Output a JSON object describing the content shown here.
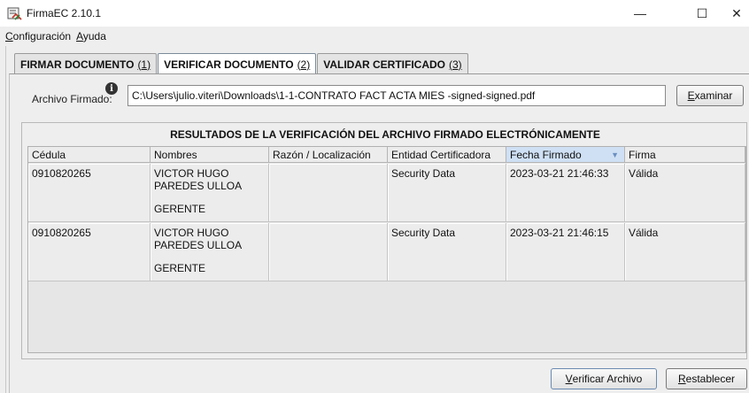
{
  "window": {
    "title": "FirmaEC 2.10.1",
    "minimize_glyph": "—",
    "maximize_glyph": "☐",
    "close_glyph": "✕"
  },
  "menu": {
    "items": [
      {
        "underlined": "C",
        "rest": "onfiguración"
      },
      {
        "underlined": "A",
        "rest": "yuda"
      }
    ]
  },
  "tabs": [
    {
      "label": "FIRMAR DOCUMENTO",
      "shortcut": "(1)",
      "active": false
    },
    {
      "label": "VERIFICAR DOCUMENTO",
      "shortcut": "(2)",
      "active": true
    },
    {
      "label": "VALIDAR CERTIFICADO",
      "shortcut": "(3)",
      "active": false
    }
  ],
  "file": {
    "label": "Archivo Firmado:",
    "info_icon": "info-icon",
    "info_glyph": "i",
    "path": "C:\\Users\\julio.viteri\\Downloads\\1-1-CONTRATO FACT ACTA MIES -signed-signed.pdf",
    "browse_underlined": "E",
    "browse_rest": "xaminar"
  },
  "results": {
    "title": "RESULTADOS DE LA VERIFICACIÓN DEL ARCHIVO FIRMADO ELECTRÓNICAMENTE",
    "columns": [
      "Cédula",
      "Nombres",
      "Razón / Localización",
      "Entidad Certificadora",
      "Fecha Firmado",
      "Firma"
    ],
    "sorted_column_arrow": "▼",
    "rows": [
      {
        "cedula": "0910820265",
        "nombre_1": "VICTOR HUGO",
        "nombre_2": "PAREDES ULLOA",
        "cargo": "GERENTE",
        "razon": "",
        "entidad": "Security Data",
        "fecha": "2023-03-21 21:46:33",
        "firma": "Válida"
      },
      {
        "cedula": "0910820265",
        "nombre_1": "VICTOR HUGO",
        "nombre_2": "PAREDES ULLOA",
        "cargo": "GERENTE",
        "razon": "",
        "entidad": "Security Data",
        "fecha": "2023-03-21 21:46:15",
        "firma": "Válida"
      }
    ]
  },
  "buttons": {
    "verificar_underlined": "V",
    "verificar_rest": "erificar Archivo",
    "restablecer_underlined": "R",
    "restablecer_rest": "establecer"
  },
  "colors": {
    "sorted_header": "#cfe0f4",
    "panel_background": "#eeeeee"
  }
}
